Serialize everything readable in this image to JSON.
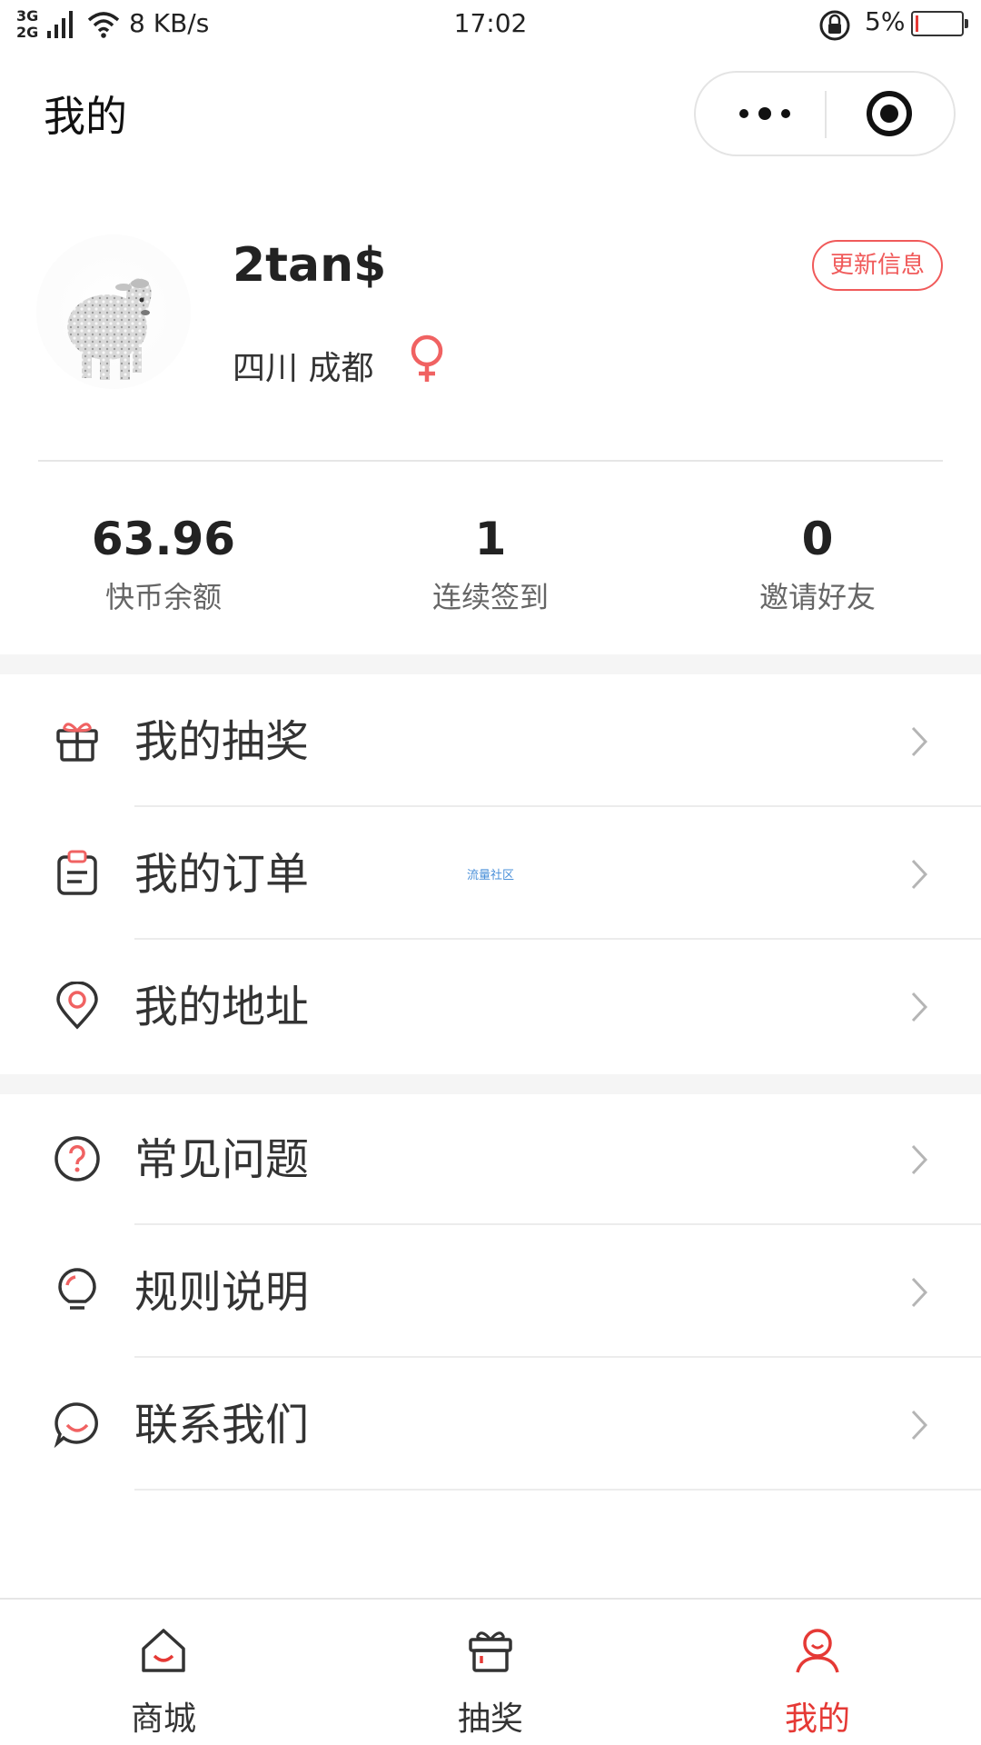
{
  "status_bar": {
    "network_label_top": "3G",
    "network_label_bottom": "2G",
    "speed": "8 KB/s",
    "time": "17:02",
    "battery_percent": "5%",
    "battery_level": 0.05
  },
  "nav": {
    "title": "我的"
  },
  "profile": {
    "username": "2tan$",
    "location": "四川 成都",
    "update_button": "更新信息"
  },
  "stats": [
    {
      "value": "63.96",
      "label": "快币余额"
    },
    {
      "value": "1",
      "label": "连续签到"
    },
    {
      "value": "0",
      "label": "邀请好友"
    }
  ],
  "menu": [
    {
      "label": "我的抽奖",
      "icon": "gift-icon"
    },
    {
      "label": "我的订单",
      "icon": "clipboard-icon"
    },
    {
      "label": "我的地址",
      "icon": "location-pin-icon"
    },
    {
      "label": "常见问题",
      "icon": "question-icon"
    },
    {
      "label": "规则说明",
      "icon": "lightbulb-icon"
    },
    {
      "label": "联系我们",
      "icon": "chat-smile-icon"
    }
  ],
  "watermark": "流量社区",
  "tabbar": [
    {
      "label": "商城",
      "icon": "home-icon",
      "active": false
    },
    {
      "label": "抽奖",
      "icon": "gift-box-icon",
      "active": false
    },
    {
      "label": "我的",
      "icon": "user-icon",
      "active": true
    }
  ],
  "colors": {
    "accent": "#e53935",
    "update_button": "#f05a5a",
    "icon_red": "#f06262",
    "text_dark": "#333333",
    "divider": "#ececec",
    "section_gap": "#f5f5f5"
  }
}
